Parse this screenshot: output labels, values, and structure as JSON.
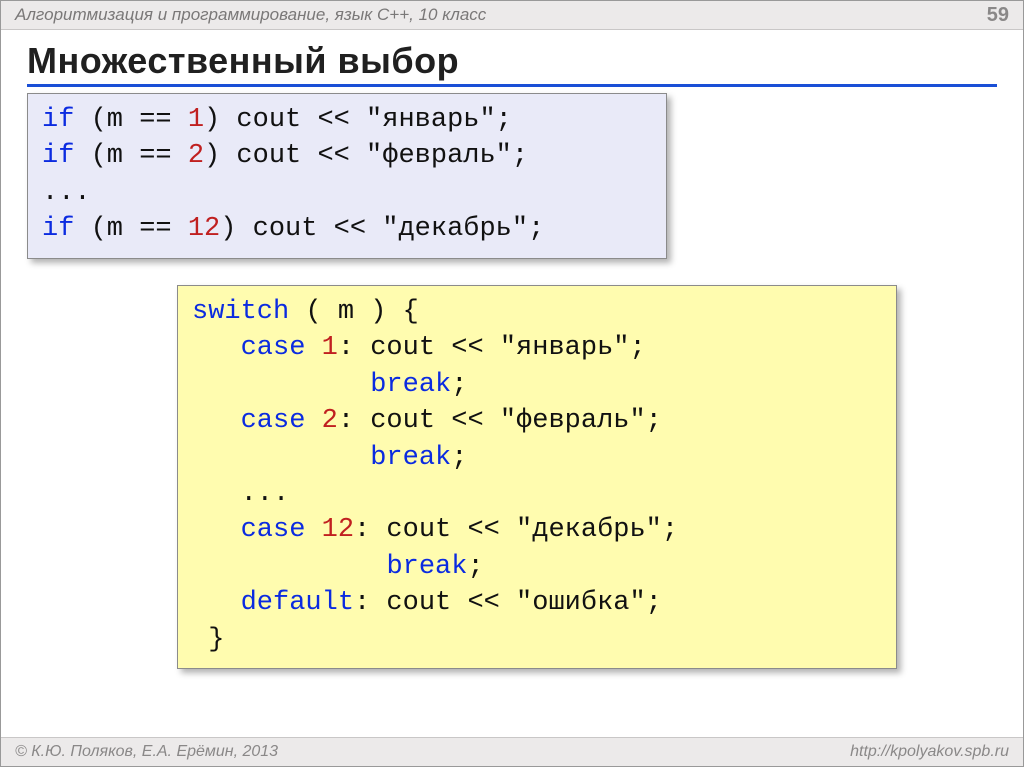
{
  "header": {
    "course": "Алгоритмизация и программирование, язык  C++, 10 класс",
    "page": "59"
  },
  "title": "Множественный выбор",
  "code_if": {
    "l1": {
      "kw": "if",
      "cond_open": " (m == ",
      "n": "1",
      "cond_close": ") cout << \"январь\";"
    },
    "l2": {
      "kw": "if",
      "cond_open": " (m == ",
      "n": "2",
      "cond_close": ") cout << \"февраль\";"
    },
    "dots": "...",
    "l4": {
      "kw": "if",
      "cond_open": " (m == ",
      "n": "12",
      "cond_close": ") cout << \"декабрь\";"
    }
  },
  "code_switch": {
    "open": {
      "kw": "switch",
      "rest": " ( m ) { "
    },
    "c1": {
      "pad": "   ",
      "kw": "case",
      "sp": " ",
      "n": "1",
      "rest": ": cout << \"январь\";"
    },
    "b1": {
      "pad": "           ",
      "kw": "break",
      "rest": ";"
    },
    "c2": {
      "pad": "   ",
      "kw": "case",
      "sp": " ",
      "n": "2",
      "rest": ": cout << \"февраль\"; "
    },
    "b2": {
      "pad": "           ",
      "kw": "break",
      "rest": ";"
    },
    "dots": {
      "pad": "   ",
      "d": "..."
    },
    "c12": {
      "pad": "   ",
      "kw": "case",
      "sp": " ",
      "n": "12",
      "rest": ": cout << \"декабрь\";"
    },
    "b12": {
      "pad": "            ",
      "kw": "break",
      "rest": ";"
    },
    "def": {
      "pad": "   ",
      "kw": "default",
      "rest": ": cout << \"ошибка\";"
    },
    "close": " }"
  },
  "footer": {
    "left": "© К.Ю. Поляков, Е.А. Ерёмин, 2013",
    "right": "http://kpolyakov.spb.ru"
  }
}
